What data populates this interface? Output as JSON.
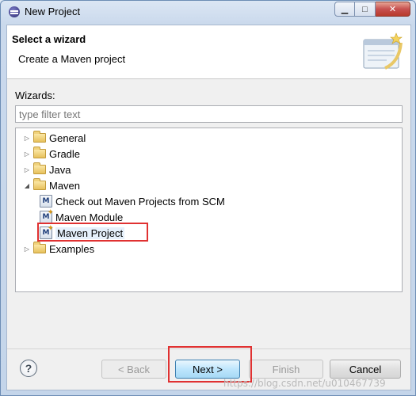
{
  "window": {
    "title": "New Project",
    "minimize_glyph": "▁",
    "maximize_glyph": "□",
    "close_glyph": "✕"
  },
  "header": {
    "title": "Select a wizard",
    "description": "Create a Maven project"
  },
  "wizards": {
    "label": "Wizards:",
    "filter_placeholder": "type filter text"
  },
  "tree": {
    "items": [
      {
        "label": "General",
        "icon": "folder-icon",
        "expanded": false
      },
      {
        "label": "Gradle",
        "icon": "folder-icon",
        "expanded": false
      },
      {
        "label": "Java",
        "icon": "folder-icon",
        "expanded": false
      },
      {
        "label": "Maven",
        "icon": "folder-open-icon",
        "expanded": true
      },
      {
        "label": "Check out Maven Projects from SCM",
        "icon": "maven-checkout-icon"
      },
      {
        "label": "Maven Module",
        "icon": "maven-module-icon"
      },
      {
        "label": "Maven Project",
        "icon": "maven-project-icon",
        "selected": true
      },
      {
        "label": "Examples",
        "icon": "folder-icon",
        "expanded": false
      }
    ]
  },
  "buttons": {
    "help": "?",
    "back": "< Back",
    "next": "Next >",
    "finish": "Finish",
    "cancel": "Cancel"
  },
  "watermark": "https://blog.csdn.net/u010467739",
  "colors": {
    "highlight_border": "#e03131",
    "selection": "#e5f0fb",
    "title_bar": "#cad9ec"
  }
}
